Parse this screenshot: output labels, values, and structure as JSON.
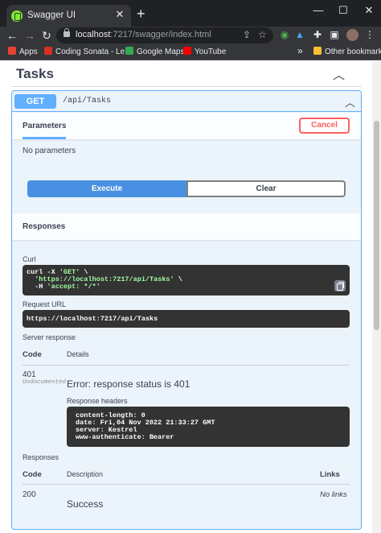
{
  "browser": {
    "tab_title": "Swagger UI",
    "tab_close": "✕",
    "new_tab": "+",
    "win_minimize": "—",
    "win_maximize": "☐",
    "win_close": "✕",
    "url_host": "localhost",
    "url_rest": ":7217/swagger/index.html",
    "bookmarks": [
      {
        "label": "Apps",
        "color": "#ea4335"
      },
      {
        "label": "Coding Sonata - Le...",
        "color": "#d93025"
      },
      {
        "label": "Google Maps",
        "color": "#34a853"
      },
      {
        "label": "YouTube",
        "color": "#ff0000"
      }
    ],
    "more_bookmarks": "»",
    "other_bookmarks": "Other bookmarks"
  },
  "section": {
    "title": "Tasks",
    "chevron": "︿"
  },
  "operation": {
    "method": "GET",
    "path": "/api/Tasks",
    "chevron": "︿",
    "parameters_tab": "Parameters",
    "cancel_label": "Cancel",
    "no_parameters": "No parameters",
    "execute_label": "Execute",
    "clear_label": "Clear"
  },
  "responses": {
    "title": "Responses",
    "curl_label": "Curl",
    "curl_lines": [
      {
        "a": "curl -X ",
        "b": "'GET'",
        "c": " \\"
      },
      {
        "a": "  ",
        "b": "'https://localhost:7217/api/Tasks'",
        "c": " \\"
      },
      {
        "a": "  -H ",
        "b": "'accept: */*'",
        "c": ""
      }
    ],
    "request_url_label": "Request URL",
    "request_url": "https://localhost:7217/api/Tasks",
    "server_response_label": "Server response",
    "code_header": "Code",
    "details_header": "Details",
    "server_code": "401",
    "undocumented": "Undocumented",
    "error_text": "Error: response status is 401",
    "response_headers_label": "Response headers",
    "response_headers": [
      "content-length: 0",
      "date: Fri,04 Nov 2022 21:33:27 GMT",
      "server: Kestrel",
      "www-authenticate: Bearer"
    ],
    "responses_label": "Responses",
    "description_header": "Description",
    "links_header": "Links",
    "doc_code": "200",
    "doc_description": "Success",
    "doc_links": "No links"
  },
  "colors": {
    "get_accent": "#61affe",
    "execute": "#4990e2",
    "cancel": "#ff6060",
    "codebox": "#333333"
  }
}
